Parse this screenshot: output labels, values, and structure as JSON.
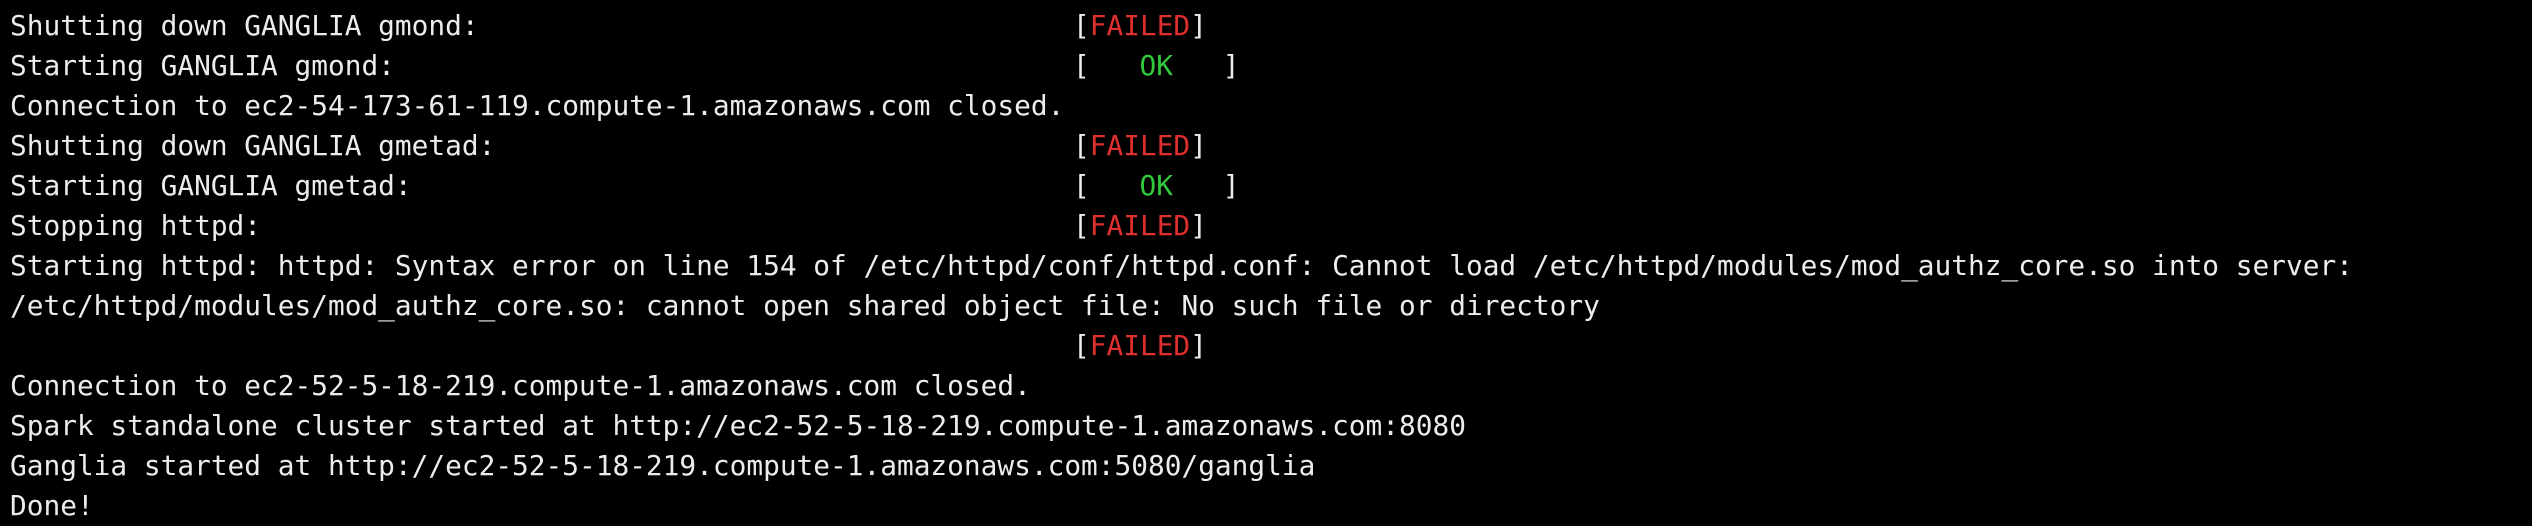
{
  "colors": {
    "background": "#000000",
    "foreground": "#ececec",
    "failed": "#e0302d",
    "ok": "#30c83a"
  },
  "terminal": {
    "bracket_open": "[",
    "bracket_close": "]",
    "lines": [
      {
        "text": "Shutting down GANGLIA gmond:",
        "status": "FAILED"
      },
      {
        "text": "Starting GANGLIA gmond:",
        "status": "OK"
      },
      {
        "text": "Connection to ec2-54-173-61-119.compute-1.amazonaws.com closed."
      },
      {
        "text": "Shutting down GANGLIA gmetad:",
        "status": "FAILED"
      },
      {
        "text": "Starting GANGLIA gmetad:",
        "status": "OK"
      },
      {
        "text": "Stopping httpd:",
        "status": "FAILED"
      },
      {
        "text": "Starting httpd: httpd: Syntax error on line 154 of /etc/httpd/conf/httpd.conf: Cannot load /etc/httpd/modules/mod_authz_core.so into server:"
      },
      {
        "text": "/etc/httpd/modules/mod_authz_core.so: cannot open shared object file: No such file or directory"
      },
      {
        "text": "",
        "status": "FAILED"
      },
      {
        "text": "Connection to ec2-52-5-18-219.compute-1.amazonaws.com closed."
      },
      {
        "text": "Spark standalone cluster started at http://ec2-52-5-18-219.compute-1.amazonaws.com:8080"
      },
      {
        "text": "Ganglia started at http://ec2-52-5-18-219.compute-1.amazonaws.com:5080/ganglia"
      },
      {
        "text": "Done!"
      }
    ]
  }
}
